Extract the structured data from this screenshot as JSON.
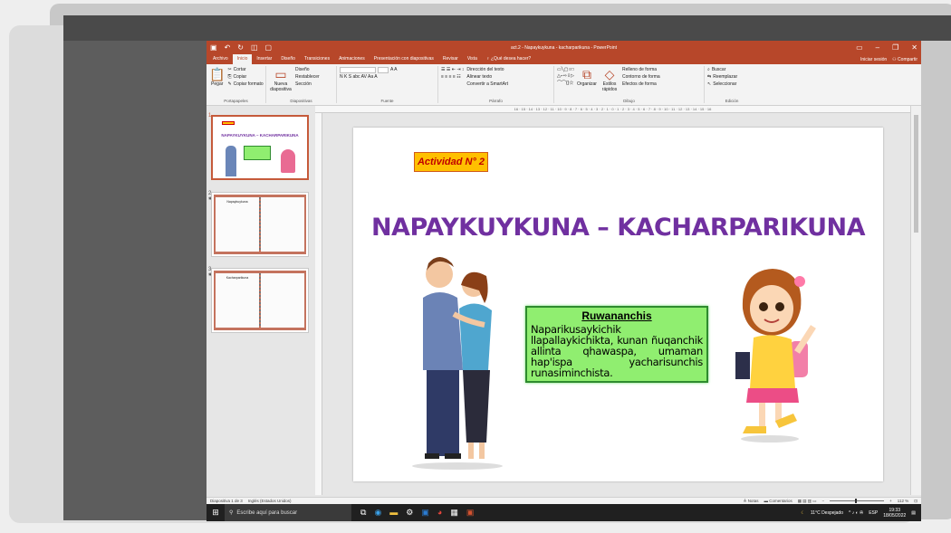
{
  "app": {
    "title": "act.2 - Napaykuykuna - kacharparikuna - PowerPoint",
    "qat_icons": [
      "save-icon",
      "undo-icon",
      "redo-icon",
      "slideshow-icon",
      "new-icon"
    ],
    "window_controls": [
      "ribbon-options-icon",
      "minimize-icon",
      "maximize-icon",
      "close-icon"
    ]
  },
  "menu": {
    "tabs": [
      "Archivo",
      "Inicio",
      "Insertar",
      "Diseño",
      "Transiciones",
      "Animaciones",
      "Presentación con diapositivas",
      "Revisar",
      "Vista"
    ],
    "active": "Inicio",
    "tell_me": "¿Qué desea hacer?",
    "signin": "Iniciar sesión",
    "share": "Compartir"
  },
  "ribbon": {
    "clipboard": {
      "label": "Portapapeles",
      "paste": "Pegar",
      "cut": "Cortar",
      "copy": "Copiar",
      "format": "Copiar formato"
    },
    "slides": {
      "label": "Diapositivas",
      "new_slide": "Nueva diapositiva",
      "layout": "Diseño",
      "reset": "Restablecer",
      "section": "Sección"
    },
    "font": {
      "label": "Fuente",
      "row2": "N K S abc AV Aa A"
    },
    "paragraph": {
      "label": "Párrafo",
      "text_dir": "Dirección del texto",
      "align": "Alinear texto",
      "smartart": "Convertir a SmartArt"
    },
    "drawing": {
      "label": "Dibujo",
      "arrange": "Organizar",
      "styles": "Estilos rápidos",
      "fill": "Relleno de forma",
      "outline": "Contorno de forma",
      "effects": "Efectos de forma"
    },
    "editing": {
      "label": "Edición",
      "find": "Buscar",
      "replace": "Reemplazar",
      "select": "Seleccionar"
    }
  },
  "thumbnails": [
    {
      "num": "1",
      "title": "NAPAYKUYKUNA – KACHARPARIKUNA",
      "selected": true
    },
    {
      "num": "2",
      "title": "Napaykuykuna",
      "selected": false
    },
    {
      "num": "3",
      "title": "Kacharparikuna",
      "selected": false
    }
  ],
  "ruler": "16 · 15 · 14 · 13 · 12 · 11 · 10 · 9 · 8 · 7 · 6 · 5 · 4 · 3 · 2 · 1 · 0 · 1 · 2 · 3 · 4 · 5 · 6 · 7 · 8 · 9 · 10 · 11 · 12 · 13 · 14 · 15 · 16",
  "slide": {
    "activity": "Actividad N° 2",
    "title": "NAPAYKUYKUNA – KACHARPARIKUNA",
    "box_heading": "Ruwananchis",
    "box_text": "Naparikusaykichik llapallaykichikta, kunan ñuqanchik allinta qhawaspa, umaman hap'ispa yacharisunchis runasiminchista."
  },
  "status": {
    "slide_info": "Diapositiva 1 de 3",
    "language": "Inglés (Estados Unidos)",
    "notes": "Notas",
    "comments": "Comentarios",
    "zoom": "112 %"
  },
  "taskbar": {
    "search": "Escribe aquí para buscar",
    "weather": "11°C Despejado",
    "lang": "ESP",
    "time": "19:33",
    "date": "18/05/2022"
  },
  "colors": {
    "accent": "#b7472a",
    "title": "#7030a0",
    "box": "#90ee70",
    "badge": "#ffc000"
  }
}
